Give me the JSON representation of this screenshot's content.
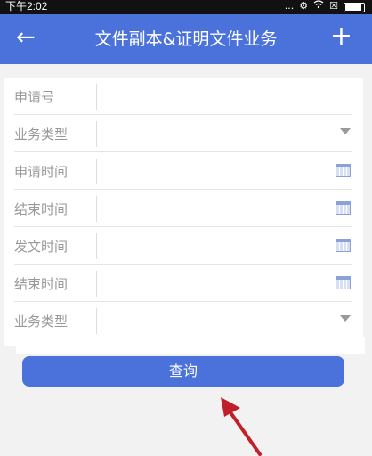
{
  "status_bar": {
    "time": "下午2:02",
    "icons": [
      "...",
      "⚙",
      "wifi",
      "☒"
    ]
  },
  "header": {
    "back_icon": "←",
    "title": "文件副本&证明文件业务",
    "add_icon": "+"
  },
  "form": {
    "rows": [
      {
        "label": "申请号",
        "value": "",
        "icon": ""
      },
      {
        "label": "业务类型",
        "value": "",
        "icon": "chevron-down-icon"
      },
      {
        "label": "申请时间",
        "value": "",
        "icon": "calendar-icon"
      },
      {
        "label": "结束时间",
        "value": "",
        "icon": "calendar-icon"
      },
      {
        "label": "发文时间",
        "value": "",
        "icon": "calendar-icon"
      },
      {
        "label": "结束时间",
        "value": "",
        "icon": "calendar-icon"
      },
      {
        "label": "业务类型",
        "value": "",
        "icon": "chevron-down-icon"
      }
    ]
  },
  "actions": {
    "query_label": "查询"
  },
  "colors": {
    "primary": "#4a72da",
    "annotation": "#c0202a"
  }
}
